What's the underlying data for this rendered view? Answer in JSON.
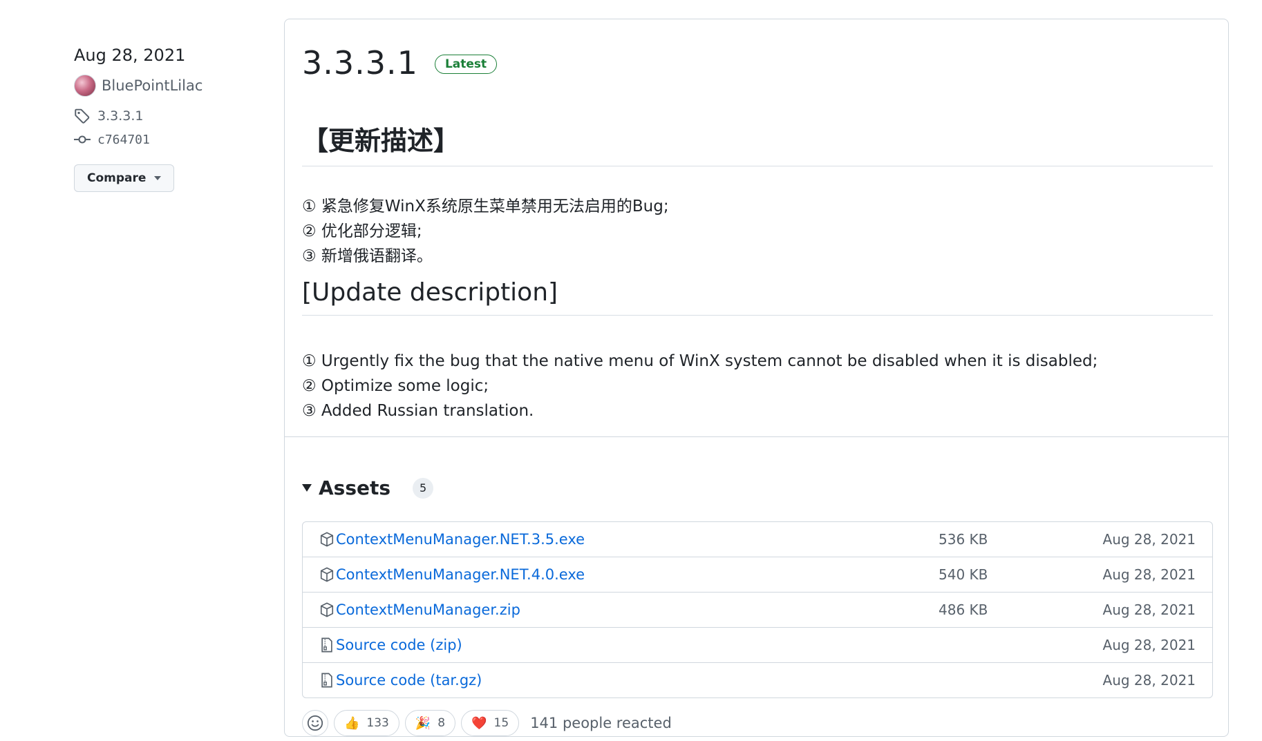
{
  "sidebar": {
    "date": "Aug 28, 2021",
    "author": "BluePointLilac",
    "tag": "3.3.3.1",
    "commit": "c764701",
    "compare_label": "Compare"
  },
  "release": {
    "title": "3.3.3.1",
    "badge": "Latest",
    "heading_cn": "【更新描述】",
    "items_cn": [
      "① 紧急修复WinX系统原生菜单禁用无法启用的Bug;",
      "② 优化部分逻辑;",
      "③ 新增俄语翻译。"
    ],
    "heading_en": "[Update description]",
    "items_en": [
      "① Urgently fix the bug that the native menu of WinX system cannot be disabled when it is disabled;",
      "② Optimize some logic;",
      "③ Added Russian translation."
    ]
  },
  "assets": {
    "title": "Assets",
    "count": "5",
    "rows": [
      {
        "icon": "package-icon",
        "name": "ContextMenuManager.NET.3.5.exe",
        "ext": "",
        "size": "536 KB",
        "date": "Aug 28, 2021"
      },
      {
        "icon": "package-icon",
        "name": "ContextMenuManager.NET.4.0.exe",
        "ext": "",
        "size": "540 KB",
        "date": "Aug 28, 2021"
      },
      {
        "icon": "package-icon",
        "name": "ContextMenuManager.zip",
        "ext": "",
        "size": "486 KB",
        "date": "Aug 28, 2021"
      },
      {
        "icon": "file-zip-icon",
        "name": "Source code",
        "ext": "(zip)",
        "size": "",
        "date": "Aug 28, 2021"
      },
      {
        "icon": "file-zip-icon",
        "name": "Source code",
        "ext": "(tar.gz)",
        "size": "",
        "date": "Aug 28, 2021"
      }
    ]
  },
  "reactions": {
    "items": [
      {
        "emoji": "👍",
        "name": "thumbs-up",
        "count": "133"
      },
      {
        "emoji": "🎉",
        "name": "hooray",
        "count": "8"
      },
      {
        "emoji": "❤️",
        "name": "heart",
        "count": "15"
      }
    ],
    "summary": "141 people reacted"
  },
  "colors": {
    "link": "#0969da",
    "latest_badge": "#1a7f37",
    "border": "#d0d7de",
    "muted": "#57606a"
  }
}
